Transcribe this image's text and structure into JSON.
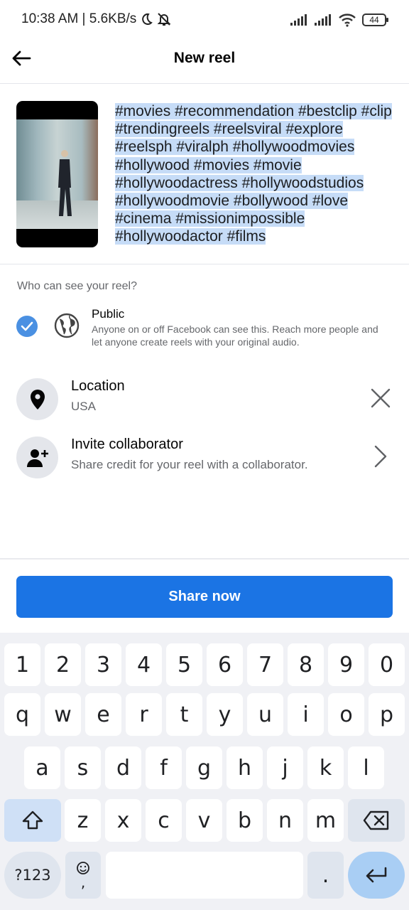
{
  "status_bar": {
    "time_speed": "10:38 AM | 5.6KB/s",
    "battery": "44"
  },
  "header": {
    "title": "New reel"
  },
  "composer": {
    "caption_lines": [
      "#movies #recommendation #bestclip #clip",
      "#trendingreels #reelsviral #explore",
      "#reelsph #viralph #hollywoodmovies",
      "#hollywood #movies #movie",
      "#hollywoodactress #hollywoodstudios",
      "#hollywoodmovie #bollywood #love",
      "#cinema #missionimpossible",
      "#hollywoodactor  #films"
    ]
  },
  "visibility": {
    "heading": "Who can see your reel?",
    "option_title": "Public",
    "option_desc": "Anyone on or off Facebook can see this. Reach more people and let anyone create reels with your original audio."
  },
  "location": {
    "title": "Location",
    "value": "USA"
  },
  "collaborator": {
    "title": "Invite collaborator",
    "desc": "Share credit for your reel with a collaborator."
  },
  "share": {
    "label": "Share now"
  },
  "keyboard": {
    "row1": [
      "1",
      "2",
      "3",
      "4",
      "5",
      "6",
      "7",
      "8",
      "9",
      "0"
    ],
    "row2": [
      "q",
      "w",
      "e",
      "r",
      "t",
      "y",
      "u",
      "i",
      "o",
      "p"
    ],
    "row3": [
      "a",
      "s",
      "d",
      "f",
      "g",
      "h",
      "j",
      "k",
      "l"
    ],
    "row4": [
      "z",
      "x",
      "c",
      "v",
      "b",
      "n",
      "m"
    ],
    "symbols_label": "?123",
    "comma_label": ",",
    "period_label": "."
  },
  "colors": {
    "accent": "#1b74e4",
    "selection": "#c6dcf7",
    "check": "#4a90e2"
  }
}
